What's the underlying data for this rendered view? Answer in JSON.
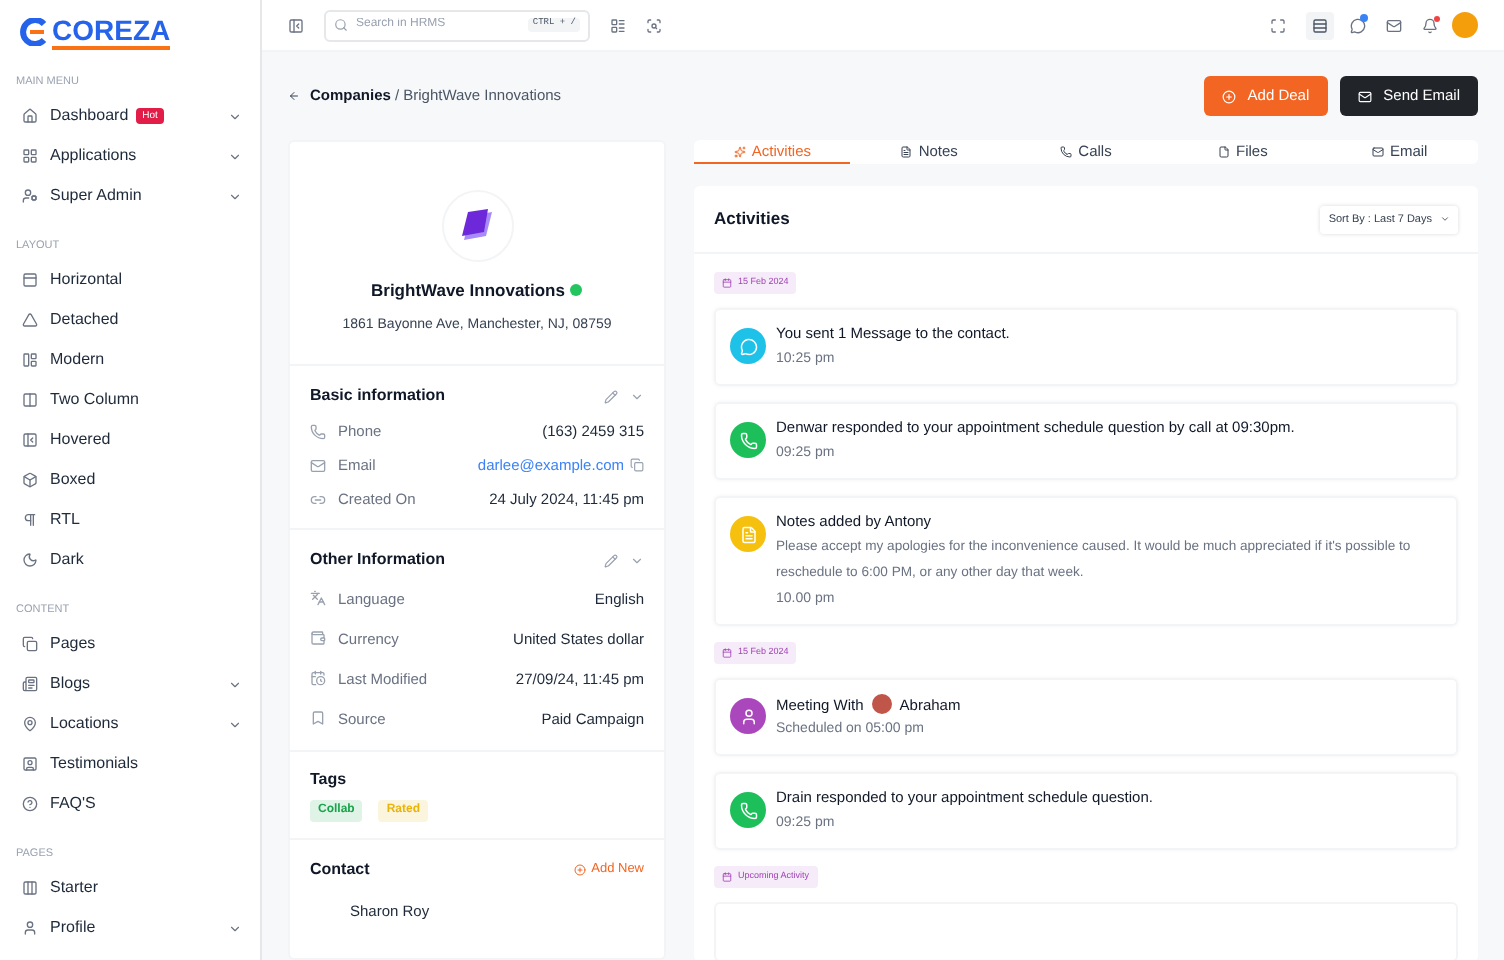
{
  "logo": {
    "text": "COREZA"
  },
  "sidebar": {
    "sections": [
      {
        "title": "MAIN MENU",
        "items": [
          {
            "label": "Dashboard",
            "badge": "Hot",
            "has_submenu": true
          },
          {
            "label": "Applications",
            "has_submenu": true
          },
          {
            "label": "Super Admin",
            "has_submenu": true
          }
        ]
      },
      {
        "title": "LAYOUT",
        "items": [
          {
            "label": "Horizontal",
            "has_submenu": false
          },
          {
            "label": "Detached",
            "has_submenu": false
          },
          {
            "label": "Modern",
            "has_submenu": false
          },
          {
            "label": "Two Column",
            "has_submenu": false
          },
          {
            "label": "Hovered",
            "has_submenu": false
          },
          {
            "label": "Boxed",
            "has_submenu": false
          },
          {
            "label": "RTL",
            "has_submenu": false
          },
          {
            "label": "Dark",
            "has_submenu": false
          }
        ]
      },
      {
        "title": "CONTENT",
        "items": [
          {
            "label": "Pages",
            "has_submenu": false
          },
          {
            "label": "Blogs",
            "has_submenu": true
          },
          {
            "label": "Locations",
            "has_submenu": true
          },
          {
            "label": "Testimonials",
            "has_submenu": false
          },
          {
            "label": "FAQ'S",
            "has_submenu": false
          }
        ]
      },
      {
        "title": "PAGES",
        "items": [
          {
            "label": "Starter",
            "has_submenu": false
          },
          {
            "label": "Profile",
            "has_submenu": true
          }
        ]
      }
    ]
  },
  "topbar": {
    "search": {
      "placeholder": "Search in HRMS",
      "shortcut": "CTRL + /"
    },
    "chat_unread": true,
    "notifications_unread": true
  },
  "breadcrumb": {
    "parent": "Companies",
    "current": "/ BrightWave Innovations"
  },
  "actions": [
    {
      "label": "Add Deal",
      "kind": "primary"
    },
    {
      "label": "Send Email",
      "kind": "dark"
    }
  ],
  "company": {
    "name": "BrightWave Innovations",
    "verified": true,
    "address": "1861 Bayonne Ave, Manchester, NJ, 08759"
  },
  "basic_information": {
    "title": "Basic information",
    "rows": [
      {
        "label": "Phone",
        "value": "(163) 2459 315"
      },
      {
        "label": "Email",
        "value": "darlee@example.com",
        "kind": "link"
      },
      {
        "label": "Created On",
        "value": "24 July 2024, 11:45 pm"
      }
    ]
  },
  "other_information": {
    "title": "Other Information",
    "rows": [
      {
        "label": "Language",
        "value": "English"
      },
      {
        "label": "Currency",
        "value": "United States dollar"
      },
      {
        "label": "Last Modified",
        "value": "27/09/24, 11:45 pm"
      },
      {
        "label": "Source",
        "value": "Paid Campaign"
      }
    ]
  },
  "tags": {
    "title": "Tags",
    "items": [
      {
        "label": "Collab",
        "color": "#16a34a"
      },
      {
        "label": "Rated",
        "color": "#eab308"
      }
    ]
  },
  "contact": {
    "title": "Contact",
    "add_label": "Add New",
    "people": [
      "Sharon Roy"
    ]
  },
  "tabs": [
    {
      "label": "Activities",
      "selected": true
    },
    {
      "label": "Notes",
      "selected": false
    },
    {
      "label": "Calls",
      "selected": false
    },
    {
      "label": "Files",
      "selected": false
    },
    {
      "label": "Email",
      "selected": false
    }
  ],
  "activities": {
    "title": "Activities",
    "sort": "Sort By : Last 7 Days",
    "groups": [
      {
        "label": "15 Feb 2024",
        "items": [
          {
            "kind": "message",
            "color": "#1ec1e8",
            "text": "You sent 1 Message to the contact.",
            "time": "10:25 pm"
          },
          {
            "kind": "call",
            "color": "#1dbf5a",
            "text": "Denwar responded to your appointment schedule question by call at 09:30pm.",
            "time": "09:25 pm"
          },
          {
            "kind": "note",
            "color": "#f5c10e",
            "text": "Notes added by Antony",
            "body": "Please accept my apologies for the inconvenience caused. It would be much appreciated if it's possible to reschedule to 6:00 PM, or any other day that week.",
            "time": "10.00 pm"
          }
        ]
      },
      {
        "label": "15 Feb 2024",
        "items": [
          {
            "kind": "meeting",
            "color": "#ab47bc",
            "text": "Meeting With",
            "person": "Abraham",
            "time": "Scheduled  on 05:00 pm"
          },
          {
            "kind": "call",
            "color": "#1dbf5a",
            "text": "Drain responded to your appointment schedule question.",
            "time": "09:25 pm"
          }
        ]
      },
      {
        "label": "Upcoming Activity"
      }
    ]
  }
}
